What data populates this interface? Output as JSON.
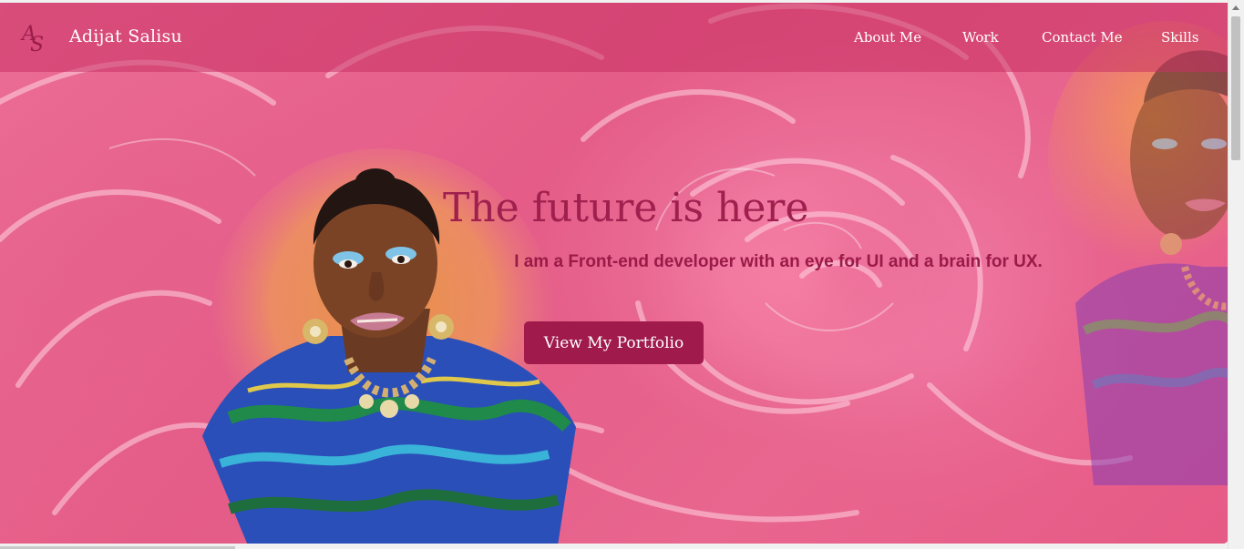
{
  "header": {
    "logo_text": "AS",
    "brand_name": "Adijat Salisu",
    "nav": [
      {
        "label": "About Me"
      },
      {
        "label": "Work"
      },
      {
        "label": "Contact Me"
      },
      {
        "label": "Skills"
      }
    ]
  },
  "hero": {
    "headline": "The future is here",
    "tagline": "I am a Front-end developer with an eye for UI and a brain for UX.",
    "cta_label": "View My Portfolio"
  },
  "icons": {
    "logo": "monogram-logo-icon",
    "scroll_up": "arrow-up-icon"
  },
  "colors": {
    "accent": "#a01a4c",
    "background": "#e8668f",
    "navbar": "#c83264"
  }
}
